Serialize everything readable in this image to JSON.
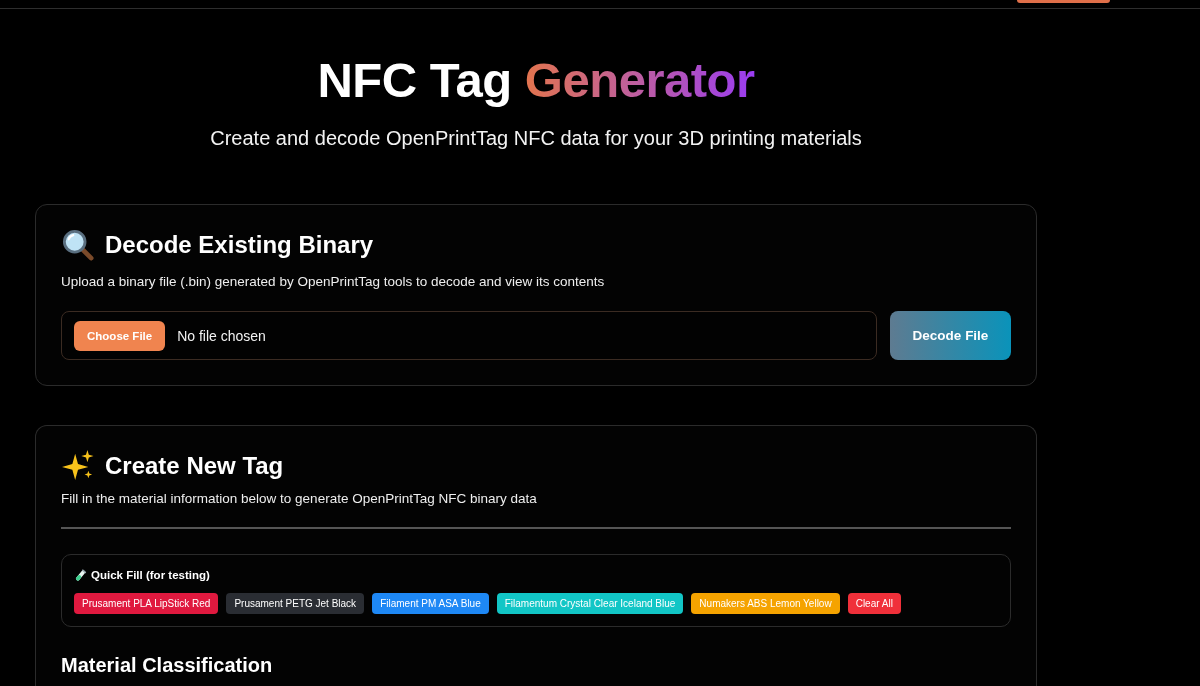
{
  "hero": {
    "title": "NFC Tag",
    "title_highlight": "Generator",
    "subtitle": "Create and decode OpenPrintTag NFC data for your 3D printing materials"
  },
  "decode_section": {
    "title": "Decode Existing Binary",
    "description": "Upload a binary file (.bin) generated by OpenPrintTag tools to decode and view its contents",
    "file_input": {
      "button": "Choose File",
      "value": "No file chosen"
    },
    "submit_button": "Decode File"
  },
  "create_section": {
    "title": "Create New Tag",
    "description": "Fill in the material information below to generate OpenPrintTag NFC binary data",
    "quick_fill": {
      "title": "Quick Fill (for testing)",
      "presets": [
        {
          "label": "Prusament PLA LipStick Red",
          "color": "#e0193f"
        },
        {
          "label": "Prusament PETG Jet Black",
          "color": "#2a2d33"
        },
        {
          "label": "Filament PM ASA Blue",
          "color": "#1e88f5"
        },
        {
          "label": "Filamentum Crystal Clear Iceland Blue",
          "color": "#12c6c6"
        },
        {
          "label": "Numakers ABS Lemon Yellow",
          "color": "#f5a300"
        },
        {
          "label": "Clear All",
          "color": "#f0303a"
        }
      ]
    },
    "next_heading": "Material Classification"
  }
}
